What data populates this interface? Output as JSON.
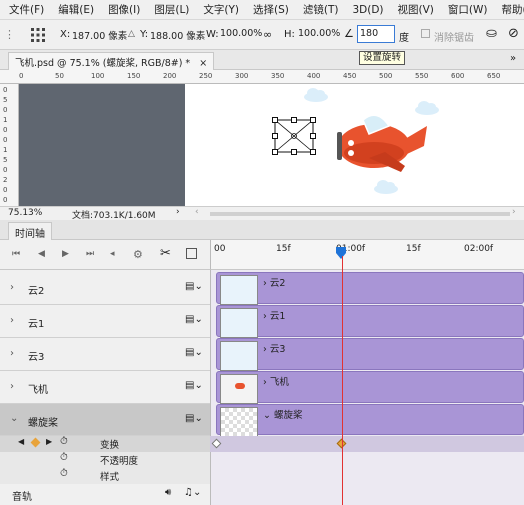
{
  "menu": [
    "文件(F)",
    "编辑(E)",
    "图像(I)",
    "图层(L)",
    "文字(Y)",
    "选择(S)",
    "滤镜(T)",
    "3D(D)",
    "视图(V)",
    "窗口(W)",
    "帮助(H)"
  ],
  "options": {
    "x_label": "X:",
    "x_value": "187.00 像素",
    "y_label": "Y:",
    "y_value": "188.00 像素",
    "w_label": "W:",
    "w_value": "100.00%",
    "h_label": "H:",
    "h_value": "100.00%",
    "rotate_value": "180",
    "rotate_unit": "度",
    "smooth_label": "消除锯齿",
    "tooltip": "设置旋转"
  },
  "document": {
    "tab_title": "飞机.psd @ 75.1% (螺旋桨, RGB/8#) *",
    "close": "×",
    "zoom": "75.13%",
    "doc_info": "文档:703.1K/1.60M"
  },
  "rulers": {
    "h_ticks": [
      "0",
      "50",
      "100",
      "150",
      "200",
      "250",
      "300",
      "350",
      "400",
      "450",
      "500",
      "550",
      "600",
      "650"
    ],
    "v_ticks": [
      "0",
      "5",
      "0",
      "1",
      "0",
      "0",
      "1",
      "5",
      "0",
      "2",
      "0",
      "0"
    ]
  },
  "timeline": {
    "title": "时间轴",
    "ruler_labels": [
      "00",
      "15f",
      "01:00f",
      "15f",
      "02:00f"
    ],
    "layers": [
      {
        "name": "云2",
        "track_name": "云2"
      },
      {
        "name": "云1",
        "track_name": "云1"
      },
      {
        "name": "云3",
        "track_name": "云3"
      },
      {
        "name": "飞机",
        "track_name": "飞机"
      },
      {
        "name": "螺旋桨",
        "track_name": "螺旋桨"
      }
    ],
    "properties": [
      "变换",
      "不透明度",
      "样式"
    ],
    "audio_label": "音轨"
  },
  "colors": {
    "track": "#a995d6",
    "playhead": "#e23232",
    "canvas_gray": "#5f6670",
    "keyframe": "#e8a33a"
  }
}
